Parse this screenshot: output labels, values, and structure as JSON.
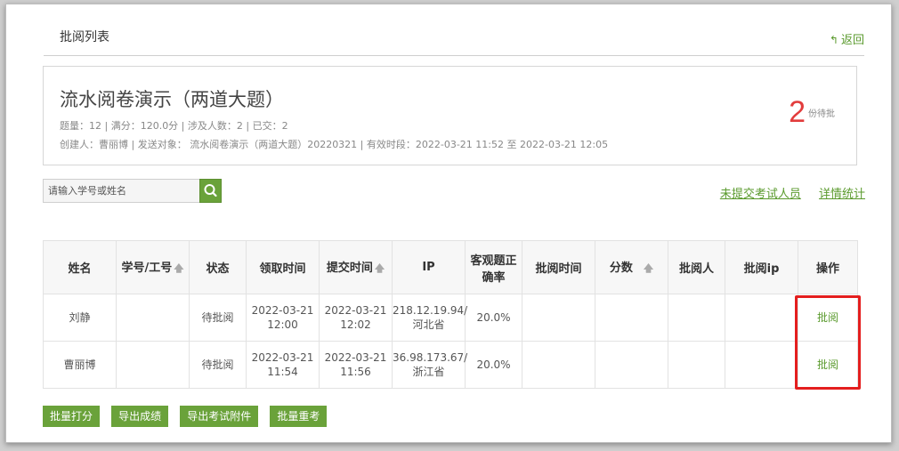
{
  "header": {
    "title": "批阅列表",
    "back_label": "返回"
  },
  "summary": {
    "exam_title": "流水阅卷演示（两道大题）",
    "meta_line1": "题量：12 |  满分：120.0分 |  涉及人数：2 | 已交：2",
    "meta_line2": "创建人：曹丽博 | 发送对象： 流水阅卷演示（两道大题）20220321  |  有效时段：2022-03-21 11:52 至 2022-03-21 12:05",
    "pending_count": "2",
    "pending_label": "份待批"
  },
  "search": {
    "placeholder": "请输入学号或姓名"
  },
  "links": {
    "unsubmitted": "未提交考试人员",
    "details": "详情统计"
  },
  "table": {
    "headers": [
      "姓名",
      "学号/工号",
      "状态",
      "领取时间",
      "提交时间",
      "IP",
      "客观题正确率",
      "批阅时间",
      "分数",
      "批阅人",
      "批阅ip",
      "操作"
    ],
    "rows": [
      {
        "name": "刘静",
        "student_id": "",
        "status": "待批阅",
        "receive_date": "2022-03-21",
        "receive_time": "12:00",
        "submit_date": "2022-03-21",
        "submit_time": "12:02",
        "ip": "218.12.19.94/",
        "ip_region": "河北省",
        "objective_rate": "20.0%",
        "review_time": "",
        "score": "",
        "reviewer": "",
        "review_ip": "",
        "action": "批阅"
      },
      {
        "name": "曹丽博",
        "student_id": "",
        "status": "待批阅",
        "receive_date": "2022-03-21",
        "receive_time": "11:54",
        "submit_date": "2022-03-21",
        "submit_time": "11:56",
        "ip": "36.98.173.67/",
        "ip_region": "浙江省",
        "objective_rate": "20.0%",
        "review_time": "",
        "score": "",
        "reviewer": "",
        "review_ip": "",
        "action": "批阅"
      }
    ]
  },
  "buttons": {
    "batch_score": "批量打分",
    "export_scores": "导出成绩",
    "export_attachments": "导出考试附件",
    "batch_retake": "批量重考"
  },
  "colors": {
    "accent": "#6aa23a",
    "link": "#5a9a2d",
    "pending": "#d03030",
    "highlight": "#e41e1e",
    "pending_count": "#e23c3c"
  },
  "icons": {
    "back": "back-arrow-icon",
    "search": "search-icon",
    "sort": "sort-up-arrow-icon"
  }
}
